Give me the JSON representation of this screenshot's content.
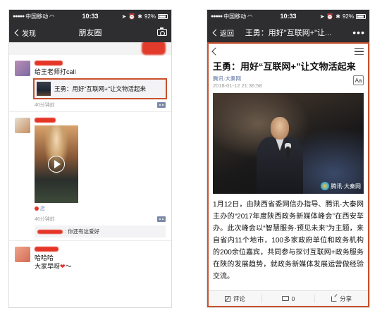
{
  "status_bar": {
    "carrier": "中国移动",
    "time": "10:33",
    "battery": "92%"
  },
  "left_screen": {
    "back_label": "发现",
    "title": "朋友圈",
    "camera_icon": "camera-icon",
    "posts": [
      {
        "text": "给王老师打call",
        "link_title": "王勇：用好\"互联网+\"让文物活起来",
        "time": "40分钟前"
      },
      {
        "location_suffix": "店",
        "time": "46分钟前",
        "comment": ": 你还有这爱好"
      },
      {
        "line1": "哈哈哈",
        "line2": "大家早呀",
        "line2_suffix": "～"
      }
    ]
  },
  "right_screen": {
    "back_label": "返回",
    "title": "王勇：用好\"互联网+\"让...",
    "more_icon": "more-icon",
    "article": {
      "headline": "王勇：用好“互联网+”让文物活起来",
      "source": "腾讯·大秦网",
      "date": "2018-01-12 21:36:58",
      "font_button": "Aa",
      "watermark": "腾讯·大秦网",
      "body": "1月12日，由陕西省委网信办指导、腾讯·大秦网主办的“2017年度陕西政务新媒体峰会”在西安举办。此次峰会以“智慧服务·预见未来”为主题，来自省内11个地市，100多家政府单位和政务机构的200余位嘉宾，共同参与探讨互联网+政务服务在陕的发展趋势，就政务新媒体发展运营做经验交流。",
      "footer": {
        "comment_label": "评论",
        "count": "0",
        "share_label": "分享"
      }
    }
  },
  "colors": {
    "highlight": "#c9512d",
    "redaction": "#e53527",
    "nav_bg": "#2e2e30"
  }
}
